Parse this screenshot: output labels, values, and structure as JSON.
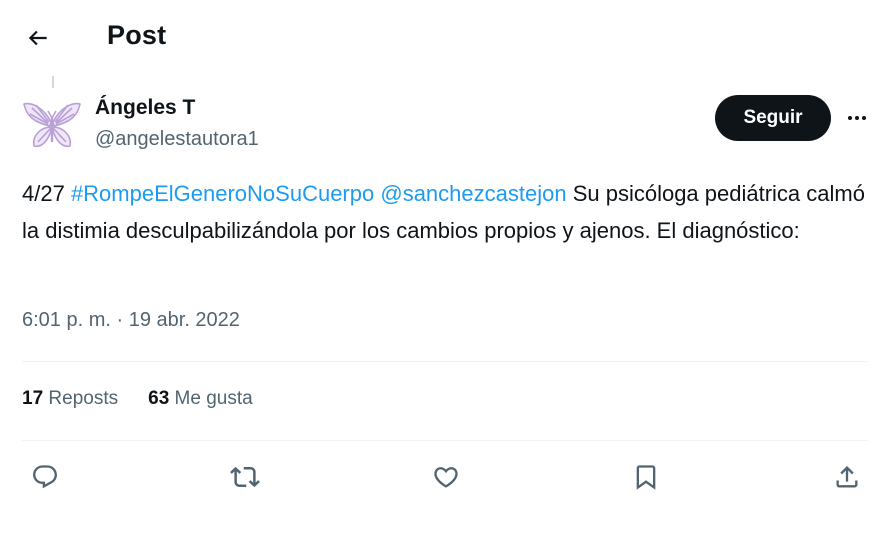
{
  "header": {
    "title": "Post",
    "back_icon": "arrow-left-icon"
  },
  "author": {
    "name": "Ángeles T",
    "handle": "@angelestautora1",
    "avatar_icon": "butterfly-icon",
    "follow_label": "Seguir",
    "more_icon": "more-horizontal-icon"
  },
  "tweet": {
    "prefix": "4/27 ",
    "hashtag": "#RompeElGeneroNoSuCuerpo",
    "space": " ",
    "mention": "@sanchezcastejon",
    "body": " Su psicóloga pediátrica calmó la distimia desculpabilizándola por los cambios propios y ajenos. El diagnóstico:",
    "timestamp": "6:01 p. m. · 19 abr. 2022"
  },
  "stats": {
    "reposts_count": "17",
    "reposts_label": "Reposts",
    "likes_count": "63",
    "likes_label": "Me gusta"
  },
  "actions": [
    "reply-icon",
    "repost-icon",
    "like-icon",
    "bookmark-icon",
    "share-icon"
  ],
  "colors": {
    "accent": "#1d9bf0",
    "text": "#0f1419",
    "secondary": "#536471",
    "button_bg": "#0f1419",
    "avatar": "#b9a0d6"
  }
}
